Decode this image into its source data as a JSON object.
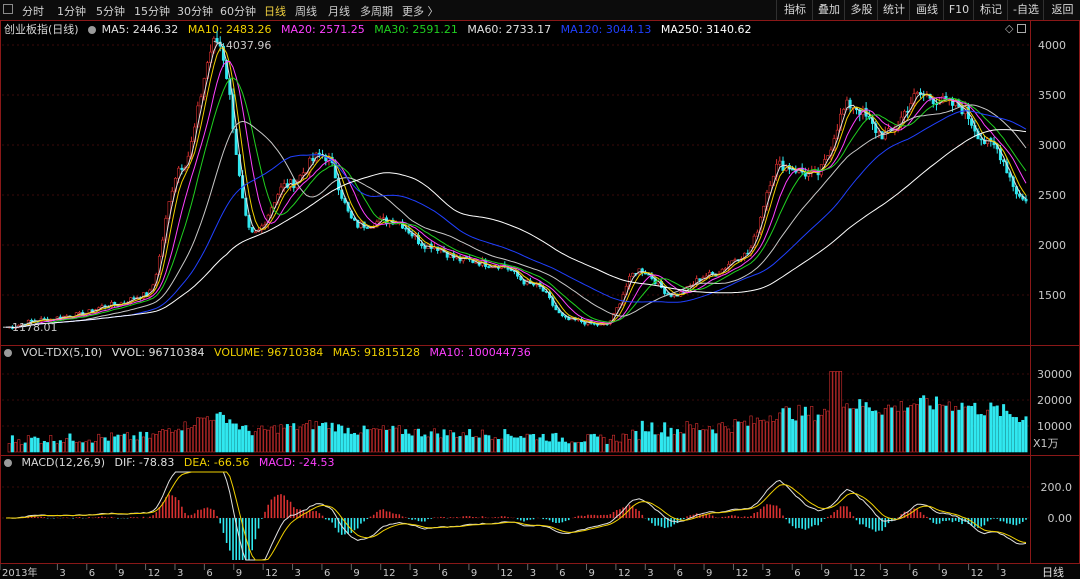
{
  "toolbar": {
    "tabs": [
      "分时",
      "1分钟",
      "5分钟",
      "15分钟",
      "30分钟",
      "60分钟",
      "日线",
      "周线",
      "月线",
      "多周期",
      "更多 〉"
    ],
    "active_tab": "日线",
    "right_buttons": [
      "指标",
      "叠加",
      "多股",
      "统计",
      "画线",
      "F10",
      "标记",
      "-自选",
      "返回"
    ]
  },
  "main_legend": {
    "name": "创业板指(日线)",
    "items": [
      {
        "label": "MA5: 2446.32",
        "color": "#e0e0e0"
      },
      {
        "label": "MA10: 2483.26",
        "color": "#f0d000"
      },
      {
        "label": "MA20: 2571.25",
        "color": "#ff40ff"
      },
      {
        "label": "MA30: 2591.21",
        "color": "#20d020"
      },
      {
        "label": "MA60: 2733.17",
        "color": "#e0e0e0"
      },
      {
        "label": "MA120: 3044.13",
        "color": "#2040ff"
      },
      {
        "label": "MA250: 3140.62",
        "color": "#ffffff"
      }
    ]
  },
  "vol_legend": {
    "name": "VOL-TDX(5,10)",
    "items": [
      {
        "label": "VVOL: 96710384",
        "color": "#e0e0e0"
      },
      {
        "label": "VOLUME: 96710384",
        "color": "#f0d000"
      },
      {
        "label": "MA5: 91815128",
        "color": "#f0d000"
      },
      {
        "label": "MA10: 100044736",
        "color": "#ff40ff"
      }
    ],
    "unit": "X1万"
  },
  "macd_legend": {
    "name": "MACD(12,26,9)",
    "items": [
      {
        "label": "DIF: -78.83",
        "color": "#e0e0e0"
      },
      {
        "label": "DEA: -66.56",
        "color": "#f0d000"
      },
      {
        "label": "MACD: -24.53",
        "color": "#ff40ff"
      }
    ]
  },
  "annotations": {
    "high": "4037.96",
    "low": "1178.01"
  },
  "price_ticks": [
    "4000",
    "3500",
    "3000",
    "2500",
    "2000",
    "1500"
  ],
  "vol_ticks": [
    "30000",
    "20000",
    "10000"
  ],
  "macd_ticks": [
    "200.0",
    "0.00"
  ],
  "date_labels": [
    "2013年",
    "3",
    "6",
    "9",
    "12",
    "3",
    "6",
    "9",
    "12",
    "3",
    "6",
    "9",
    "12",
    "3",
    "6",
    "9",
    "12",
    "3",
    "6",
    "9",
    "12",
    "3",
    "6",
    "9",
    "12",
    "3",
    "6",
    "9",
    "12",
    "3",
    "6",
    "9",
    "12",
    "3"
  ],
  "period_label": "日线",
  "chart_data": {
    "type": "line",
    "title": "创业板指(日线)",
    "x": [
      "2013-01",
      "2013-06",
      "2013-12",
      "2014-06",
      "2014-12",
      "2015-04",
      "2015-06",
      "2015-07",
      "2015-09",
      "2015-11",
      "2016-03",
      "2016-06",
      "2016-12",
      "2017-06",
      "2017-12",
      "2018-06",
      "2018-10",
      "2019-01",
      "2019-04",
      "2019-06",
      "2019-12",
      "2020-03",
      "2020-07",
      "2020-12",
      "2021-03",
      "2021-06",
      "2021-10",
      "2021-12",
      "2022-02",
      "2022-04"
    ],
    "series": [
      {
        "name": "创业板指",
        "values": [
          1178,
          1250,
          1300,
          1400,
          1500,
          2800,
          4037,
          2100,
          2600,
          2900,
          2200,
          2250,
          2000,
          1850,
          1800,
          1600,
          1250,
          1200,
          1750,
          1500,
          1700,
          1900,
          2800,
          2700,
          3400,
          3100,
          3500,
          3400,
          3000,
          2440
        ]
      }
    ],
    "ylim": [
      1100,
      4100
    ],
    "grid": true
  }
}
